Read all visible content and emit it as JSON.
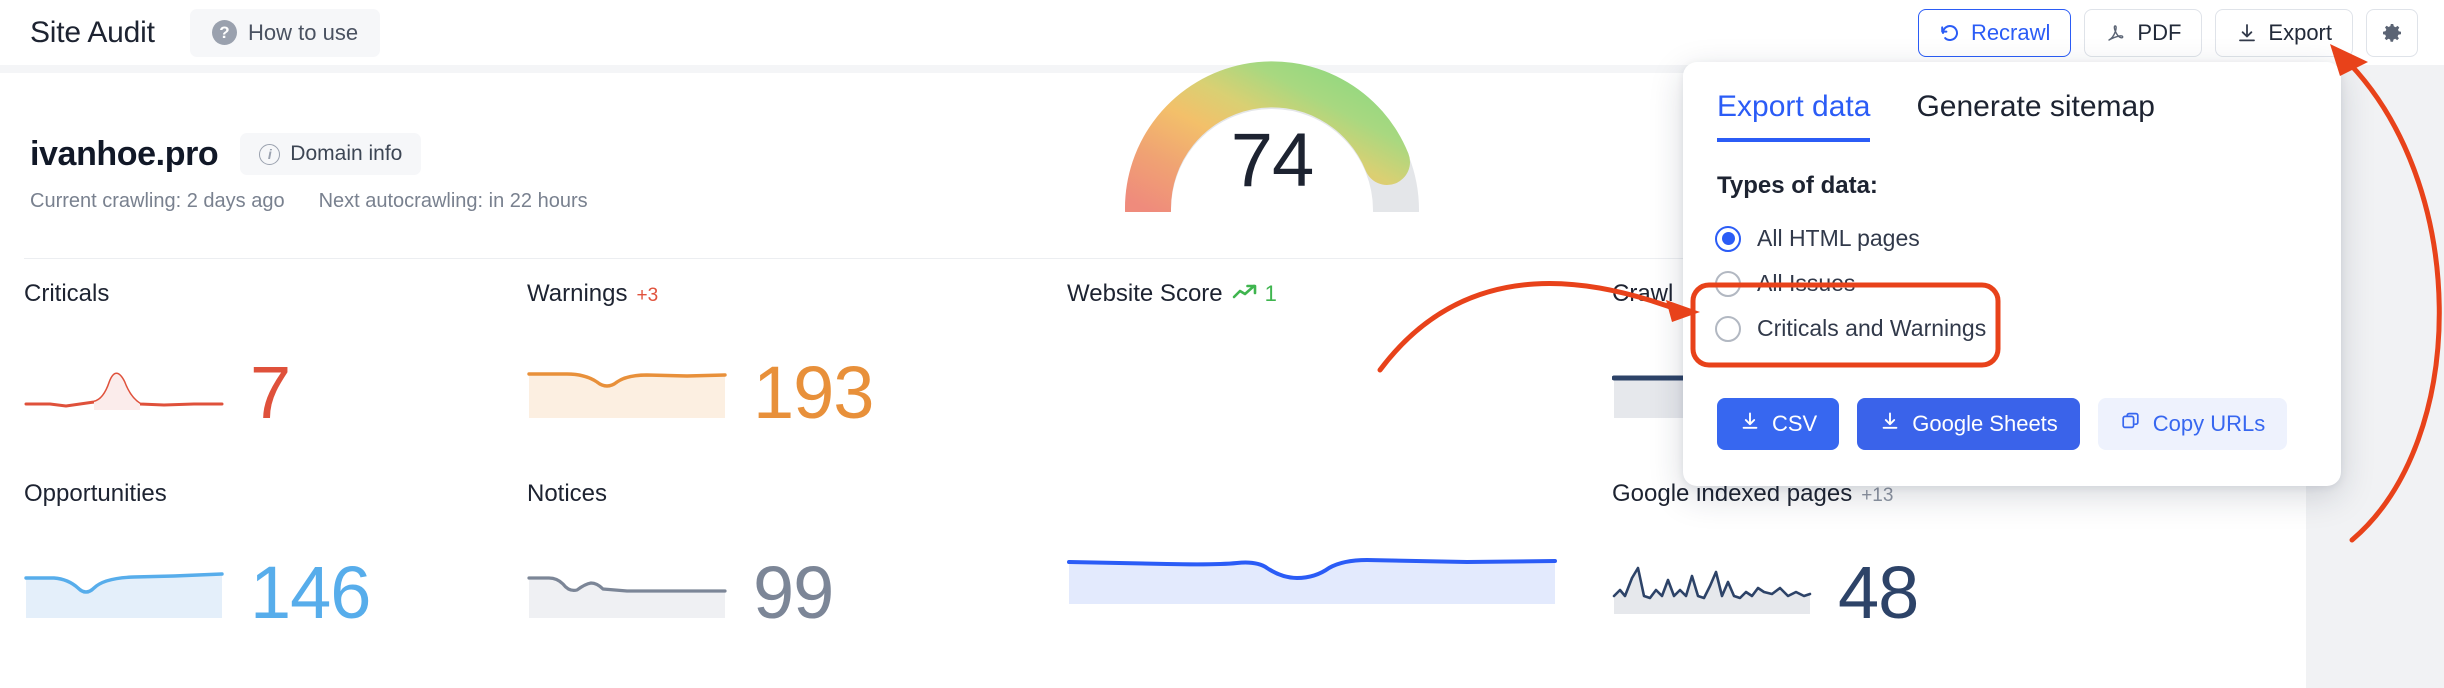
{
  "topbar": {
    "title": "Site Audit",
    "how_to_use": "How to use",
    "actions": [
      {
        "label": "Recrawl",
        "icon": "refresh-icon",
        "style": "primary-outline"
      },
      {
        "label": "PDF",
        "icon": "pdf-icon",
        "style": "default"
      },
      {
        "label": "Export",
        "icon": "download-icon",
        "style": "default"
      },
      {
        "label": "",
        "icon": "gear-icon",
        "style": "icon-only"
      }
    ]
  },
  "domain": {
    "name": "ivanhoe.pro",
    "info_label": "Domain info",
    "current_crawling": "Current crawling: 2 days ago",
    "next_autocrawling": "Next autocrawling: in 22 hours"
  },
  "metrics": [
    {
      "key": "criticals",
      "title": "Criticals",
      "delta": "",
      "value": "7",
      "color": "#df513b"
    },
    {
      "key": "warnings",
      "title": "Warnings",
      "delta": "+3",
      "value": "193",
      "color": "#e8903a"
    },
    {
      "key": "website_score",
      "title": "Website Score",
      "trend": "1",
      "value": "74",
      "color": "#1d2331"
    },
    {
      "key": "crawled_pages",
      "title": "Crawl",
      "delta": "",
      "value": "",
      "color": "#2d4368"
    },
    {
      "key": "opportunities",
      "title": "Opportunities",
      "delta": "",
      "value": "146",
      "color": "#57adeb"
    },
    {
      "key": "notices",
      "title": "Notices",
      "delta": "",
      "value": "99",
      "color": "#7c8697"
    },
    {
      "key": "google_indexed_pages",
      "title": "Google indexed pages",
      "delta": "+13",
      "value": "48",
      "color": "#2d4368"
    }
  ],
  "export_popup": {
    "tabs": [
      {
        "label": "Export data",
        "active": true
      },
      {
        "label": "Generate sitemap",
        "active": false
      }
    ],
    "section_title": "Types of data:",
    "options": [
      {
        "label": "All HTML pages",
        "checked": true
      },
      {
        "label": "All Issues",
        "checked": false
      },
      {
        "label": "Criticals and Warnings",
        "checked": false
      }
    ],
    "buttons": [
      {
        "label": "CSV",
        "icon": "download-icon",
        "style": "blue"
      },
      {
        "label": "Google Sheets",
        "icon": "download-icon",
        "style": "blue2"
      },
      {
        "label": "Copy URLs",
        "icon": "copy-icon",
        "style": "ghost"
      }
    ]
  },
  "chart_data": [
    {
      "type": "line",
      "title": "Criticals",
      "values": [
        7,
        7,
        6.5,
        7,
        13,
        7,
        6.8,
        7,
        7
      ],
      "color": "#df513b"
    },
    {
      "type": "area",
      "title": "Warnings",
      "values": [
        193,
        193,
        190,
        186,
        192,
        193,
        193,
        193
      ],
      "color": "#e8903a"
    },
    {
      "type": "gauge",
      "title": "Website Score",
      "value": 74,
      "range": [
        0,
        100
      ],
      "trend": 1
    },
    {
      "type": "area",
      "title": "Crawled pages",
      "values": [
        100,
        100,
        100,
        100,
        100
      ],
      "color": "#2d4368"
    },
    {
      "type": "area",
      "title": "Opportunities",
      "values": [
        146,
        146,
        143,
        140,
        145,
        146,
        147,
        147
      ],
      "color": "#57adeb"
    },
    {
      "type": "area",
      "title": "Notices",
      "values": [
        99,
        99,
        97,
        95,
        98,
        96,
        96,
        96
      ],
      "color": "#7c8697"
    },
    {
      "type": "area",
      "title": "Google indexed pages",
      "values": [
        30,
        48,
        80,
        35,
        30,
        52,
        34,
        60,
        38,
        75,
        36,
        82,
        40,
        50,
        74,
        36,
        44,
        40,
        45,
        38
      ],
      "color": "#2d4368"
    }
  ],
  "annotations": {
    "highlight_options": "Criticals and Warnings / All Issues radio group highlighted",
    "arrow_to_export": "Curved arrow pointing to Export button",
    "arrow_to_options": "Curved arrow pointing to highlighted radio options"
  }
}
